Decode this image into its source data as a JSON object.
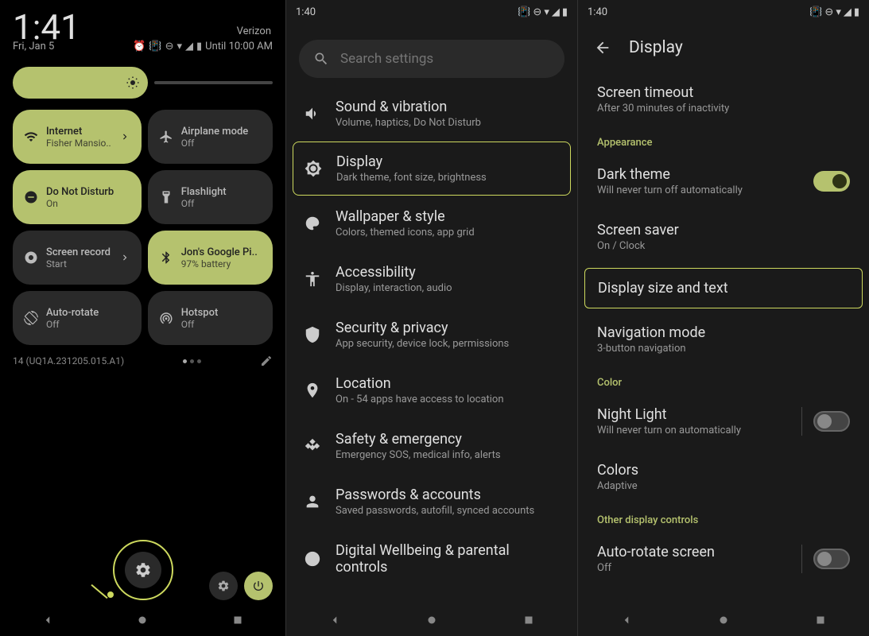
{
  "panel1": {
    "clock": "1:41",
    "carrier": "Verizon",
    "date": "Fri, Jan 5",
    "dnd_until": "Until 10:00 AM",
    "tiles": [
      {
        "title": "Internet",
        "sub": "Fisher Mansio..",
        "active": true,
        "chevron": true,
        "icon": "wifi"
      },
      {
        "title": "Airplane mode",
        "sub": "Off",
        "active": false,
        "icon": "airplane"
      },
      {
        "title": "Do Not Disturb",
        "sub": "On",
        "active": true,
        "icon": "dnd"
      },
      {
        "title": "Flashlight",
        "sub": "Off",
        "active": false,
        "icon": "flashlight"
      },
      {
        "title": "Screen record",
        "sub": "Start",
        "active": false,
        "chevron": true,
        "icon": "record"
      },
      {
        "title": "Jon's Google Pi..",
        "sub": "97% battery",
        "active": true,
        "icon": "bluetooth"
      },
      {
        "title": "Auto-rotate",
        "sub": "Off",
        "active": false,
        "icon": "rotate"
      },
      {
        "title": "Hotspot",
        "sub": "Off",
        "active": false,
        "icon": "hotspot"
      }
    ],
    "build": "14 (UQ1A.231205.015.A1)"
  },
  "panel2": {
    "time": "1:40",
    "search_placeholder": "Search settings",
    "items": [
      {
        "title": "Sound & vibration",
        "sub": "Volume, haptics, Do Not Disturb",
        "icon": "volume"
      },
      {
        "title": "Display",
        "sub": "Dark theme, font size, brightness",
        "icon": "brightness",
        "highlighted": true
      },
      {
        "title": "Wallpaper & style",
        "sub": "Colors, themed icons, app grid",
        "icon": "palette"
      },
      {
        "title": "Accessibility",
        "sub": "Display, interaction, audio",
        "icon": "accessibility"
      },
      {
        "title": "Security & privacy",
        "sub": "App security, device lock, permissions",
        "icon": "shield"
      },
      {
        "title": "Location",
        "sub": "On - 54 apps have access to location",
        "icon": "location"
      },
      {
        "title": "Safety & emergency",
        "sub": "Emergency SOS, medical info, alerts",
        "icon": "emergency"
      },
      {
        "title": "Passwords & accounts",
        "sub": "Saved passwords, autofill, synced accounts",
        "icon": "account"
      },
      {
        "title": "Digital Wellbeing & parental controls",
        "sub": "",
        "icon": "wellbeing"
      }
    ]
  },
  "panel3": {
    "time": "1:40",
    "title": "Display",
    "screen_timeout": {
      "title": "Screen timeout",
      "sub": "After 30 minutes of inactivity"
    },
    "section_appearance": "Appearance",
    "dark_theme": {
      "title": "Dark theme",
      "sub": "Will never turn off automatically",
      "on": true
    },
    "screen_saver": {
      "title": "Screen saver",
      "sub": "On / Clock"
    },
    "display_size": {
      "title": "Display size and text",
      "highlighted": true
    },
    "nav_mode": {
      "title": "Navigation mode",
      "sub": "3-button navigation"
    },
    "section_color": "Color",
    "night_light": {
      "title": "Night Light",
      "sub": "Will never turn on automatically",
      "on": false
    },
    "colors": {
      "title": "Colors",
      "sub": "Adaptive"
    },
    "section_other": "Other display controls",
    "auto_rotate": {
      "title": "Auto-rotate screen",
      "sub": "Off",
      "on": false
    }
  }
}
